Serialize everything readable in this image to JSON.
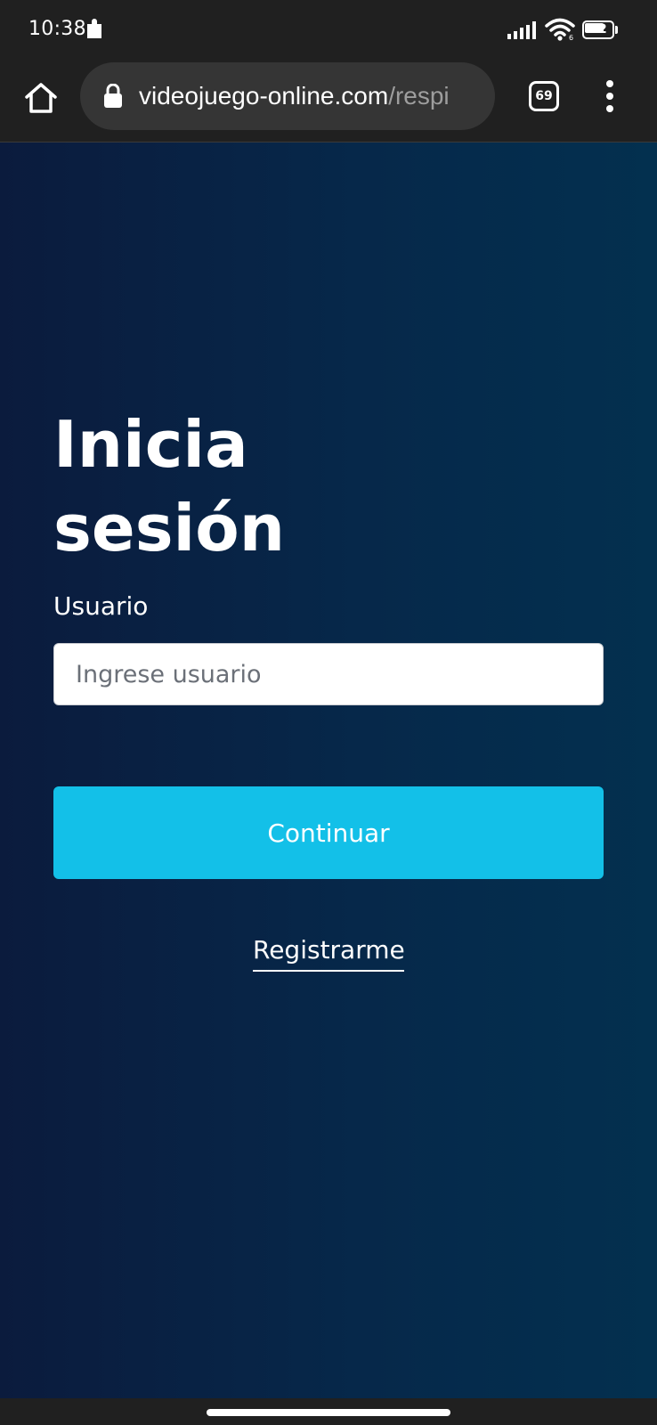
{
  "status_bar": {
    "time": "10:38",
    "battery_level": "72",
    "icons": [
      "notification-icon",
      "signal-icon",
      "wifi-icon",
      "battery-icon"
    ]
  },
  "browser": {
    "url_domain": "videojuego-online.com",
    "url_path": "/respi",
    "tab_count": "69",
    "icons": [
      "home-icon",
      "lock-icon",
      "tabs-icon",
      "overflow-menu-icon"
    ]
  },
  "login": {
    "title_line1": "Inicia",
    "title_line2": "sesión",
    "username_label": "Usuario",
    "username_placeholder": "Ingrese usuario",
    "username_value": "",
    "continue_label": "Continuar",
    "register_label": "Registrarme"
  },
  "colors": {
    "background_start": "#0b1b3d",
    "background_end": "#03304f",
    "primary_button": "#13c0e8",
    "chrome_bar": "#202020"
  }
}
